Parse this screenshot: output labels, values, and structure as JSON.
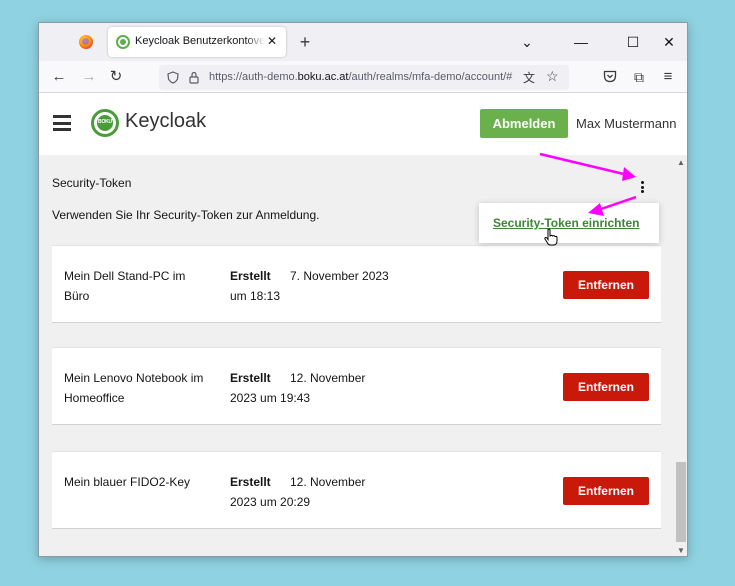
{
  "browser": {
    "tab": {
      "title": "Keycloak Benutzerkontoverwaltung"
    },
    "url": {
      "prefix": "https://auth-demo.",
      "host": "boku.ac.at",
      "path": "/auth/realms/mfa-demo/account/#"
    }
  },
  "header": {
    "brand": "Keycloak",
    "logout_label": "Abmelden",
    "username": "Max Mustermann"
  },
  "section": {
    "title": "Security-Token",
    "description": "Verwenden Sie Ihr Security-Token zur Anmeldung."
  },
  "dropdown": {
    "item_label": "Security-Token einrichten"
  },
  "tokens": [
    {
      "name": "Mein Dell Stand-PC im Büro",
      "created_label": "Erstellt",
      "created_date": "7. November 2023 um 18:13",
      "remove_label": "Entfernen"
    },
    {
      "name": "Mein Lenovo Notebook im Homeoffice",
      "created_label": "Erstellt",
      "created_date": "12. November 2023 um 19:43",
      "remove_label": "Entfernen"
    },
    {
      "name": "Mein blauer FIDO2-Key",
      "created_label": "Erstellt",
      "created_date": "12. November 2023 um 20:29",
      "remove_label": "Entfernen"
    }
  ],
  "colors": {
    "logout_button": "#6ab04c",
    "remove_button": "#c9190b",
    "link_green": "#3e8635",
    "annotation_arrow": "#ff00ff"
  }
}
